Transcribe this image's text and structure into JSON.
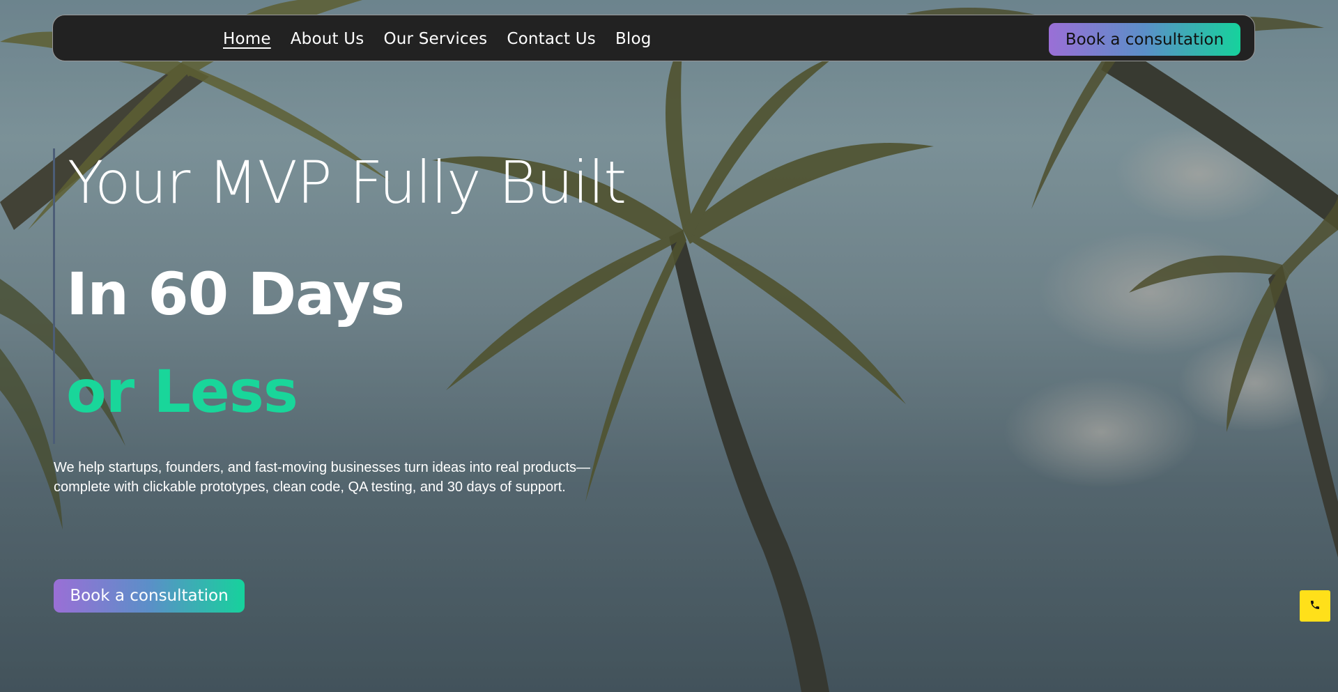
{
  "nav": {
    "links": [
      {
        "label": "Home",
        "active": true
      },
      {
        "label": "About Us"
      },
      {
        "label": "Our Services"
      },
      {
        "label": "Contact Us"
      },
      {
        "label": "Blog"
      }
    ],
    "cta_label": "Book a consultation"
  },
  "hero": {
    "line1": "Your MVP Fully Built",
    "line2": "In 60 Days",
    "line3": "or Less",
    "description_line1": "We help startups, founders, and fast-moving businesses turn ideas into real products—",
    "description_line2": "complete with clickable prototypes, clean code, QA testing, and 30 days of support.",
    "cta_label": "Book a consultation"
  },
  "floating": {
    "phone_icon": "phone-icon"
  },
  "colors": {
    "accent_green": "#19d69a",
    "gradient_start": "#9a6fd6",
    "gradient_end": "#16d29c",
    "navbar_bg": "#222222",
    "phone_button_bg": "#ffe01a"
  }
}
